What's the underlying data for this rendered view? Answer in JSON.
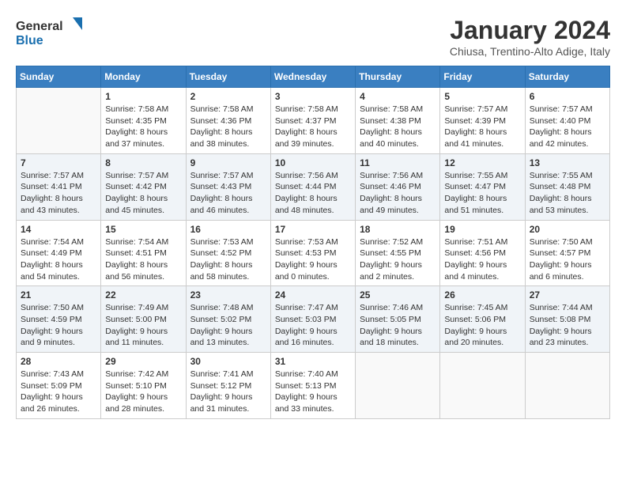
{
  "header": {
    "logo_general": "General",
    "logo_blue": "Blue",
    "month": "January 2024",
    "location": "Chiusa, Trentino-Alto Adige, Italy"
  },
  "days_of_week": [
    "Sunday",
    "Monday",
    "Tuesday",
    "Wednesday",
    "Thursday",
    "Friday",
    "Saturday"
  ],
  "weeks": [
    [
      {
        "day": "",
        "info": ""
      },
      {
        "day": "1",
        "sunrise": "7:58 AM",
        "sunset": "4:35 PM",
        "daylight": "8 hours and 37 minutes."
      },
      {
        "day": "2",
        "sunrise": "7:58 AM",
        "sunset": "4:36 PM",
        "daylight": "8 hours and 38 minutes."
      },
      {
        "day": "3",
        "sunrise": "7:58 AM",
        "sunset": "4:37 PM",
        "daylight": "8 hours and 39 minutes."
      },
      {
        "day": "4",
        "sunrise": "7:58 AM",
        "sunset": "4:38 PM",
        "daylight": "8 hours and 40 minutes."
      },
      {
        "day": "5",
        "sunrise": "7:57 AM",
        "sunset": "4:39 PM",
        "daylight": "8 hours and 41 minutes."
      },
      {
        "day": "6",
        "sunrise": "7:57 AM",
        "sunset": "4:40 PM",
        "daylight": "8 hours and 42 minutes."
      }
    ],
    [
      {
        "day": "7",
        "sunrise": "7:57 AM",
        "sunset": "4:41 PM",
        "daylight": "8 hours and 43 minutes."
      },
      {
        "day": "8",
        "sunrise": "7:57 AM",
        "sunset": "4:42 PM",
        "daylight": "8 hours and 45 minutes."
      },
      {
        "day": "9",
        "sunrise": "7:57 AM",
        "sunset": "4:43 PM",
        "daylight": "8 hours and 46 minutes."
      },
      {
        "day": "10",
        "sunrise": "7:56 AM",
        "sunset": "4:44 PM",
        "daylight": "8 hours and 48 minutes."
      },
      {
        "day": "11",
        "sunrise": "7:56 AM",
        "sunset": "4:46 PM",
        "daylight": "8 hours and 49 minutes."
      },
      {
        "day": "12",
        "sunrise": "7:55 AM",
        "sunset": "4:47 PM",
        "daylight": "8 hours and 51 minutes."
      },
      {
        "day": "13",
        "sunrise": "7:55 AM",
        "sunset": "4:48 PM",
        "daylight": "8 hours and 53 minutes."
      }
    ],
    [
      {
        "day": "14",
        "sunrise": "7:54 AM",
        "sunset": "4:49 PM",
        "daylight": "8 hours and 54 minutes."
      },
      {
        "day": "15",
        "sunrise": "7:54 AM",
        "sunset": "4:51 PM",
        "daylight": "8 hours and 56 minutes."
      },
      {
        "day": "16",
        "sunrise": "7:53 AM",
        "sunset": "4:52 PM",
        "daylight": "8 hours and 58 minutes."
      },
      {
        "day": "17",
        "sunrise": "7:53 AM",
        "sunset": "4:53 PM",
        "daylight": "9 hours and 0 minutes."
      },
      {
        "day": "18",
        "sunrise": "7:52 AM",
        "sunset": "4:55 PM",
        "daylight": "9 hours and 2 minutes."
      },
      {
        "day": "19",
        "sunrise": "7:51 AM",
        "sunset": "4:56 PM",
        "daylight": "9 hours and 4 minutes."
      },
      {
        "day": "20",
        "sunrise": "7:50 AM",
        "sunset": "4:57 PM",
        "daylight": "9 hours and 6 minutes."
      }
    ],
    [
      {
        "day": "21",
        "sunrise": "7:50 AM",
        "sunset": "4:59 PM",
        "daylight": "9 hours and 9 minutes."
      },
      {
        "day": "22",
        "sunrise": "7:49 AM",
        "sunset": "5:00 PM",
        "daylight": "9 hours and 11 minutes."
      },
      {
        "day": "23",
        "sunrise": "7:48 AM",
        "sunset": "5:02 PM",
        "daylight": "9 hours and 13 minutes."
      },
      {
        "day": "24",
        "sunrise": "7:47 AM",
        "sunset": "5:03 PM",
        "daylight": "9 hours and 16 minutes."
      },
      {
        "day": "25",
        "sunrise": "7:46 AM",
        "sunset": "5:05 PM",
        "daylight": "9 hours and 18 minutes."
      },
      {
        "day": "26",
        "sunrise": "7:45 AM",
        "sunset": "5:06 PM",
        "daylight": "9 hours and 20 minutes."
      },
      {
        "day": "27",
        "sunrise": "7:44 AM",
        "sunset": "5:08 PM",
        "daylight": "9 hours and 23 minutes."
      }
    ],
    [
      {
        "day": "28",
        "sunrise": "7:43 AM",
        "sunset": "5:09 PM",
        "daylight": "9 hours and 26 minutes."
      },
      {
        "day": "29",
        "sunrise": "7:42 AM",
        "sunset": "5:10 PM",
        "daylight": "9 hours and 28 minutes."
      },
      {
        "day": "30",
        "sunrise": "7:41 AM",
        "sunset": "5:12 PM",
        "daylight": "9 hours and 31 minutes."
      },
      {
        "day": "31",
        "sunrise": "7:40 AM",
        "sunset": "5:13 PM",
        "daylight": "9 hours and 33 minutes."
      },
      {
        "day": "",
        "info": ""
      },
      {
        "day": "",
        "info": ""
      },
      {
        "day": "",
        "info": ""
      }
    ]
  ]
}
